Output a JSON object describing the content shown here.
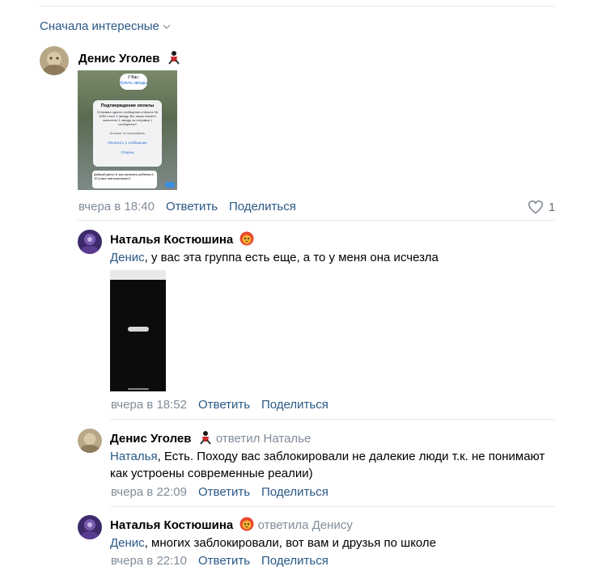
{
  "sort": {
    "label": "Сначала интересные"
  },
  "comments": [
    {
      "author": "Денис Уголев",
      "time": "вчера в 18:40",
      "reply_label": "Ответить",
      "share_label": "Поделиться",
      "likes": "1",
      "attachment": {
        "stars_badge": "У Вас:",
        "buy_stars": "Купить звёзды",
        "dialog_title": "Подтверждение оплаты",
        "dialog_body": "Отправка одного сообщения в Школа № 2084 стоит 1 звезду. Вы также можете заплатить 1 звезду за отправку 1 сообщения?",
        "dont_ask": "Больше не спрашивать",
        "pay": "Оплатить 1 сообщение",
        "cancel": "Отмена",
        "msg": "Добрый день! А как записать ребенка в 10 класс мат.вертикали?"
      }
    },
    {
      "author": "Наталья Костюшина",
      "mention": "Денис",
      "text": ", у вас эта группа есть еще, а то у меня она исчезла",
      "time": "вчера в 18:52",
      "reply_label": "Ответить",
      "share_label": "Поделиться"
    },
    {
      "author": "Денис Уголев",
      "reply_to": "ответил Наталье",
      "mention": "Наталья",
      "text": ", Есть. Походу вас заблокировали не далекие люди т.к. не понимают как устроены современные реалии)",
      "time": "вчера в 22:09",
      "reply_label": "Ответить",
      "share_label": "Поделиться"
    },
    {
      "author": "Наталья Костюшина",
      "reply_to": "ответила Денису",
      "mention": "Денис",
      "text": ", многих заблокировали, вот вам и друзья по школе",
      "time": "вчера в 22:10",
      "reply_label": "Ответить",
      "share_label": "Поделиться"
    }
  ],
  "colors": {
    "link": "#2a5885",
    "meta": "#818c99",
    "separator": "#e7e8ec"
  }
}
